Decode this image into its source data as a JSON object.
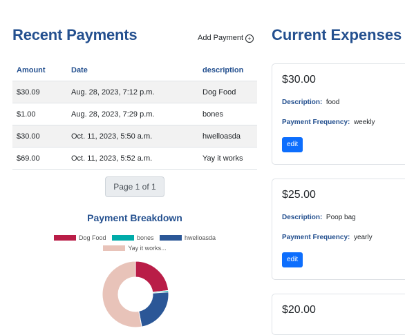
{
  "payments": {
    "title": "Recent Payments",
    "add_label": "Add Payment",
    "add_icon": "plus-circle-icon",
    "columns": [
      "Amount",
      "Date",
      "description"
    ],
    "rows": [
      {
        "amount": "$30.09",
        "date": "Aug. 28, 2023, 7:12 p.m.",
        "description": "Dog Food"
      },
      {
        "amount": "$1.00",
        "date": "Aug. 28, 2023, 7:29 p.m.",
        "description": "bones"
      },
      {
        "amount": "$30.00",
        "date": "Oct. 11, 2023, 5:50 a.m.",
        "description": "hwelloasda"
      },
      {
        "amount": "$69.00",
        "date": "Oct. 11, 2023, 5:52 a.m.",
        "description": "Yay it works"
      }
    ],
    "pagination": "Page 1 of 1"
  },
  "chart_data": {
    "type": "pie",
    "title": "Payment Breakdown",
    "categories": [
      "Dog Food",
      "bones",
      "hwelloasda",
      "Yay it works..."
    ],
    "values": [
      30.09,
      1.0,
      30.0,
      69.0
    ],
    "colors": [
      "#b91d47",
      "#00aba9",
      "#2b5797",
      "#e8c3b9"
    ],
    "legend": "top"
  },
  "expenses": {
    "title": "Current Expenses",
    "description_label": "Description:",
    "frequency_label": "Payment Frequency:",
    "edit_label": "edit",
    "cards": [
      {
        "amount": "$30.00",
        "description": "food",
        "frequency": "weekly"
      },
      {
        "amount": "$25.00",
        "description": "Poop bag",
        "frequency": "yearly"
      },
      {
        "amount": "$20.00"
      }
    ]
  }
}
